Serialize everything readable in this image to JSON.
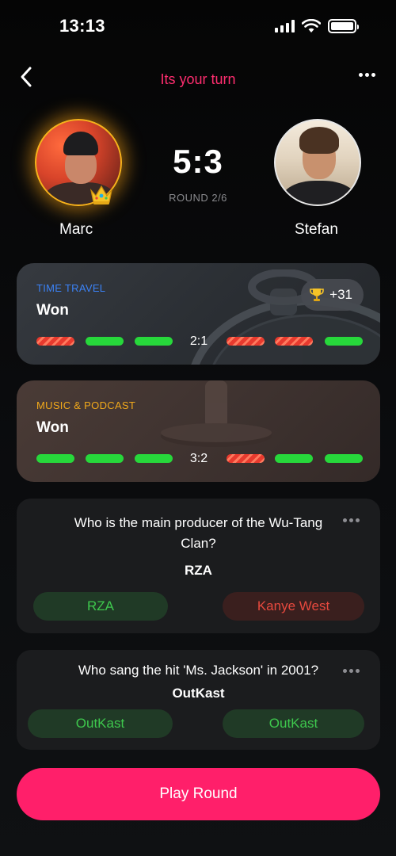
{
  "status_bar": {
    "time": "13:13"
  },
  "header": {
    "title": "Its your turn"
  },
  "players": {
    "left": {
      "name": "Marc"
    },
    "right": {
      "name": "Stefan"
    }
  },
  "match": {
    "score": "5:3",
    "round": "ROUND 2/6"
  },
  "categories": [
    {
      "label": "TIME TRAVEL",
      "result": "Won",
      "score": "2:1",
      "trophy": "+31",
      "left_bars": [
        "loss",
        "win",
        "win"
      ],
      "right_bars": [
        "loss",
        "loss",
        "win"
      ],
      "label_color": "#3b82f6"
    },
    {
      "label": "MUSIC & PODCAST",
      "result": "Won",
      "score": "3:2",
      "left_bars": [
        "win",
        "win",
        "win"
      ],
      "right_bars": [
        "loss",
        "win",
        "win"
      ],
      "label_color": "#f1a91b"
    }
  ],
  "questions": [
    {
      "text": "Who is the main producer of the Wu-Tang Clan?",
      "answer": "RZA",
      "left_answer": "RZA",
      "left_status": "correct",
      "right_answer": "Kanye West",
      "right_status": "wrong"
    },
    {
      "text": "Who sang the hit 'Ms. Jackson' in 2001?",
      "answer": "OutKast",
      "left_answer": "OutKast",
      "left_status": "correct",
      "right_answer": "OutKast",
      "right_status": "correct"
    }
  ],
  "play_button": {
    "label": "Play Round"
  },
  "colors": {
    "accent": "#ff1f6a",
    "title": "#ff2d6f",
    "win": "#27d83b",
    "loss": "#e83a2e",
    "crown_glow": "#f6b21b"
  },
  "icons": [
    "signal-icon",
    "wifi-icon",
    "battery-icon",
    "back-chevron-icon",
    "more-icon",
    "crown-icon",
    "trophy-icon"
  ]
}
